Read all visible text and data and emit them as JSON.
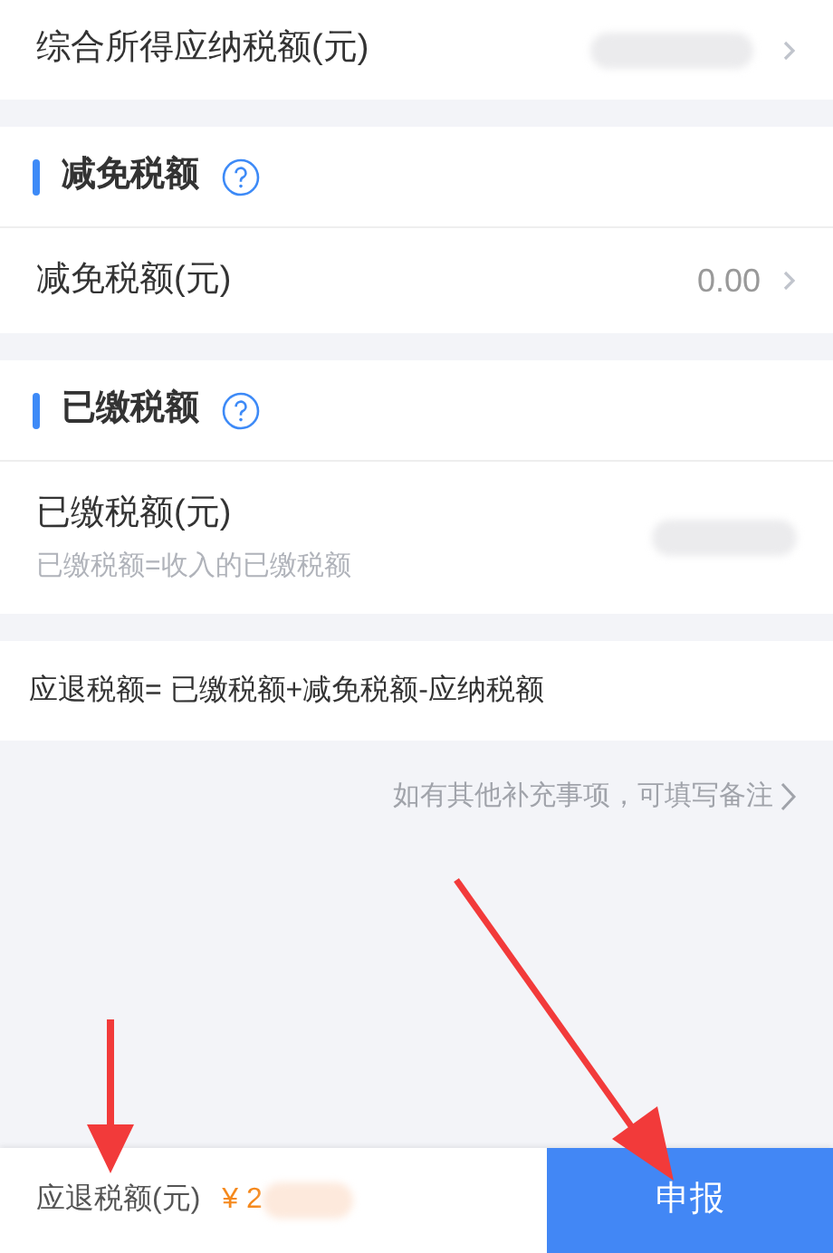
{
  "top_row": {
    "label": "综合所得应纳税额(元)"
  },
  "sections": [
    {
      "title": "减免税额",
      "row": {
        "kind": "value",
        "label": "减免税额(元)",
        "value": "0.00"
      }
    },
    {
      "title": "已缴税额",
      "row": {
        "kind": "hidden",
        "label": "已缴税额(元)",
        "hint": "已缴税额=收入的已缴税额"
      }
    }
  ],
  "formula": "应退税额= 已缴税额+减免税额-应纳税额",
  "note_link": "如有其他补充事项，可填写备注",
  "bottom_bar": {
    "label": "应退税额(元)",
    "amount": "¥ 2",
    "submit": "申报"
  }
}
